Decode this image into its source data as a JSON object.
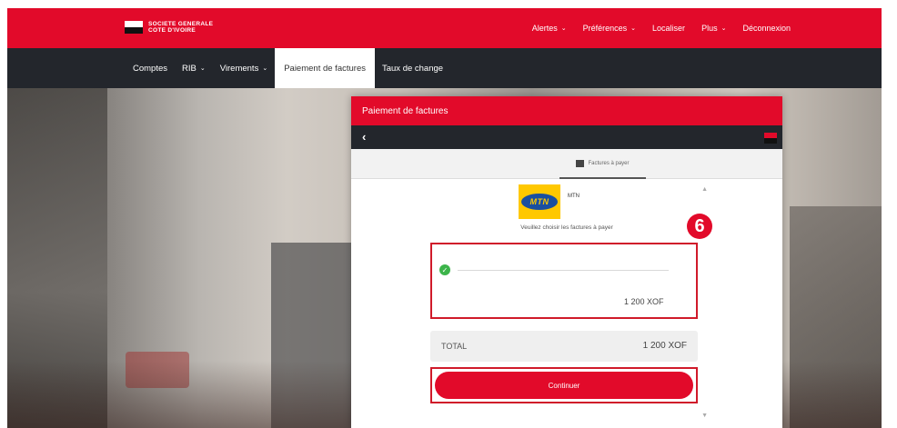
{
  "brand": {
    "line1": "SOCIETE GENERALE",
    "line2": "COTE D'IVOIRE"
  },
  "topnav": {
    "items": [
      {
        "label": "Alertes",
        "has_dropdown": true
      },
      {
        "label": "Préférences",
        "has_dropdown": true
      },
      {
        "label": "Localiser",
        "has_dropdown": false
      },
      {
        "label": "Plus",
        "has_dropdown": true
      },
      {
        "label": "Déconnexion",
        "has_dropdown": false
      }
    ]
  },
  "mainnav": {
    "items": [
      {
        "label": "Comptes",
        "has_dropdown": false
      },
      {
        "label": "RIB",
        "has_dropdown": true
      },
      {
        "label": "Virements",
        "has_dropdown": true
      },
      {
        "label": "Paiement de factures",
        "has_dropdown": false,
        "active": true
      },
      {
        "label": "Taux de change",
        "has_dropdown": false
      }
    ]
  },
  "panel": {
    "title": "Paiement de factures",
    "back_icon": "chevron-left-icon",
    "tab_label": "Factures à payer"
  },
  "biller": {
    "logo_text": "MTN",
    "name": "MTN",
    "instruction": "Veuillez choisir les factures à payer"
  },
  "step_badge": "6",
  "invoice": {
    "selected": true,
    "amount": "1 200 XOF"
  },
  "total": {
    "label": "TOTAL",
    "value": "1 200 XOF"
  },
  "continue_button": "Continuer",
  "colors": {
    "brand_red": "#e20a2a",
    "nav_dark": "#23262c",
    "check_green": "#3cb44a"
  }
}
